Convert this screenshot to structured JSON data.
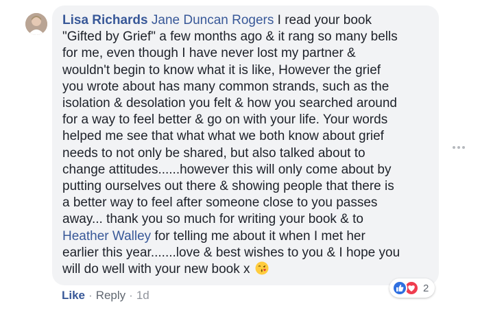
{
  "comment": {
    "author": "Lisa Richards",
    "mention_first": "Jane Duncan Rogers",
    "lines": [
      " I read your book",
      "\"Gifted by Grief\" a few months ago & it rang so many bells",
      "for me, even though I have never lost my partner &",
      "wouldn't begin to know what it is like, However the grief",
      "you wrote about has many common strands, such as the",
      "isolation & desolation you felt & how you searched around",
      "for a way to feel better & go on with your life. Your words",
      "helped me see that what what we both know about grief",
      "needs to not only be shared, but also talked about to",
      "change attitudes......however this will only come about by",
      "putting ourselves out there & showing people that there is",
      "a better way to feel after someone close to you passes",
      "away... thank you so much for writing your book & to"
    ],
    "mention_second": "Heather Walley",
    "line14_rest": " for telling me about it when I met her",
    "line15": "earlier this year.......love & best wishes to you & I hope you",
    "line16": "will do well with your new book x",
    "emoji_icon": "kissing-face-emoji"
  },
  "reactions": {
    "icons": [
      "like-reaction-icon",
      "love-reaction-icon"
    ],
    "count": "2"
  },
  "actions": {
    "like": "Like",
    "reply": "Reply",
    "separator": "·",
    "timestamp": "1d"
  },
  "colors": {
    "link": "#385898",
    "bubble": "#f2f3f5",
    "text": "#1d2129",
    "meta": "#90949c"
  }
}
